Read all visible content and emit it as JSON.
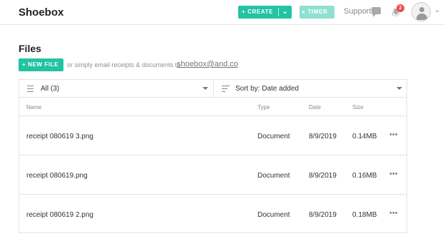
{
  "app": {
    "brand": "Shoebox"
  },
  "header": {
    "create_label": "+ CREATE",
    "timer_label": "▸ TIMER",
    "support_label": "Support",
    "notification_count": "2"
  },
  "colors": {
    "accent": "#22c3a3",
    "accent_light": "#8ee0cf",
    "badge": "#ea4b4b"
  },
  "icons": [
    "chat-icon",
    "notification-icon",
    "user-avatar-icon",
    "list-icon",
    "sort-icon"
  ],
  "main": {
    "title": "Files",
    "new_file_label": "+ NEW FILE",
    "hint": "or simply email receipts & documents to",
    "email": "shoebox@and.co"
  },
  "table": {
    "filter_value": "All (3)",
    "sort_value": "Sort by: Date added",
    "columns": {
      "name": "Name",
      "type": "Type",
      "date": "Date",
      "size": "Size"
    },
    "rows": [
      {
        "name": "receipt 080619 3.png",
        "type": "Document",
        "date": "8/9/2019",
        "size": "0.14MB"
      },
      {
        "name": "receipt 080619.png",
        "type": "Document",
        "date": "8/9/2019",
        "size": "0.16MB"
      },
      {
        "name": "receipt 080619 2.png",
        "type": "Document",
        "date": "8/9/2019",
        "size": "0.18MB"
      }
    ]
  }
}
